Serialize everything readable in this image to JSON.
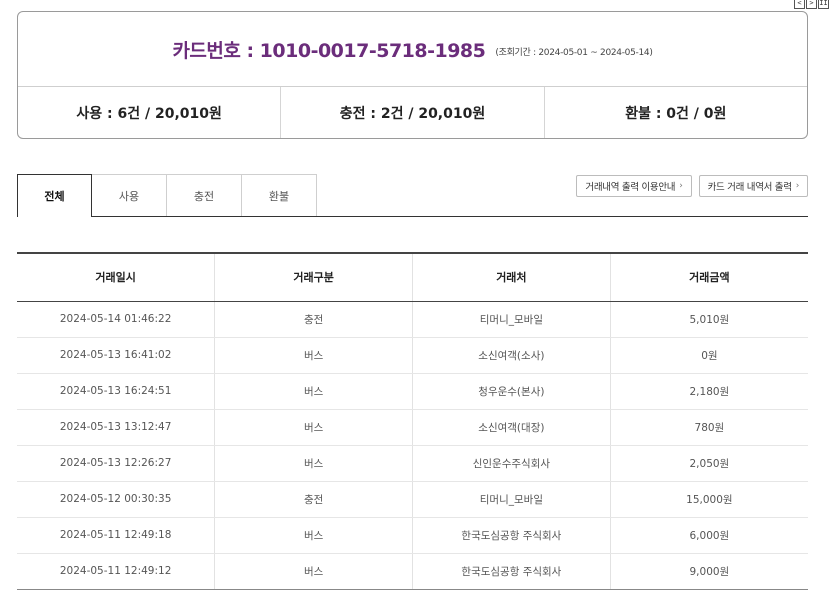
{
  "window_controls": [
    "<",
    ">",
    "II"
  ],
  "card": {
    "title": "카드번호 : 1010-0017-5718-1985",
    "period": "(조회기간 : 2024-05-01 ~ 2024-05-14)",
    "stats": [
      {
        "label": "사용 : 6건 / 20,010원"
      },
      {
        "label": "충전 : 2건 / 20,010원"
      },
      {
        "label": "환불 : 0건 / 0원"
      }
    ]
  },
  "tabs": [
    {
      "label": "전체",
      "active": true
    },
    {
      "label": "사용",
      "active": false
    },
    {
      "label": "충전",
      "active": false
    },
    {
      "label": "환불",
      "active": false
    }
  ],
  "buttons": {
    "guide": "거래내역 출력 이용안내",
    "print": "카드 거래 내역서 출력",
    "arrow": "›"
  },
  "table": {
    "headers": [
      "거래일시",
      "거래구분",
      "거래처",
      "거래금액"
    ],
    "rows": [
      [
        "2024-05-14 01:46:22",
        "충전",
        "티머니_모바일",
        "5,010원"
      ],
      [
        "2024-05-13 16:41:02",
        "버스",
        "소신여객(소사)",
        "0원"
      ],
      [
        "2024-05-13 16:24:51",
        "버스",
        "청우운수(본사)",
        "2,180원"
      ],
      [
        "2024-05-13 13:12:47",
        "버스",
        "소신여객(대장)",
        "780원"
      ],
      [
        "2024-05-13 12:26:27",
        "버스",
        "신인운수주식회사",
        "2,050원"
      ],
      [
        "2024-05-12 00:30:35",
        "충전",
        "티머니_모바일",
        "15,000원"
      ],
      [
        "2024-05-11 12:49:18",
        "버스",
        "한국도심공항 주식회사",
        "6,000원"
      ],
      [
        "2024-05-11 12:49:12",
        "버스",
        "한국도심공항 주식회사",
        "9,000원"
      ]
    ]
  }
}
